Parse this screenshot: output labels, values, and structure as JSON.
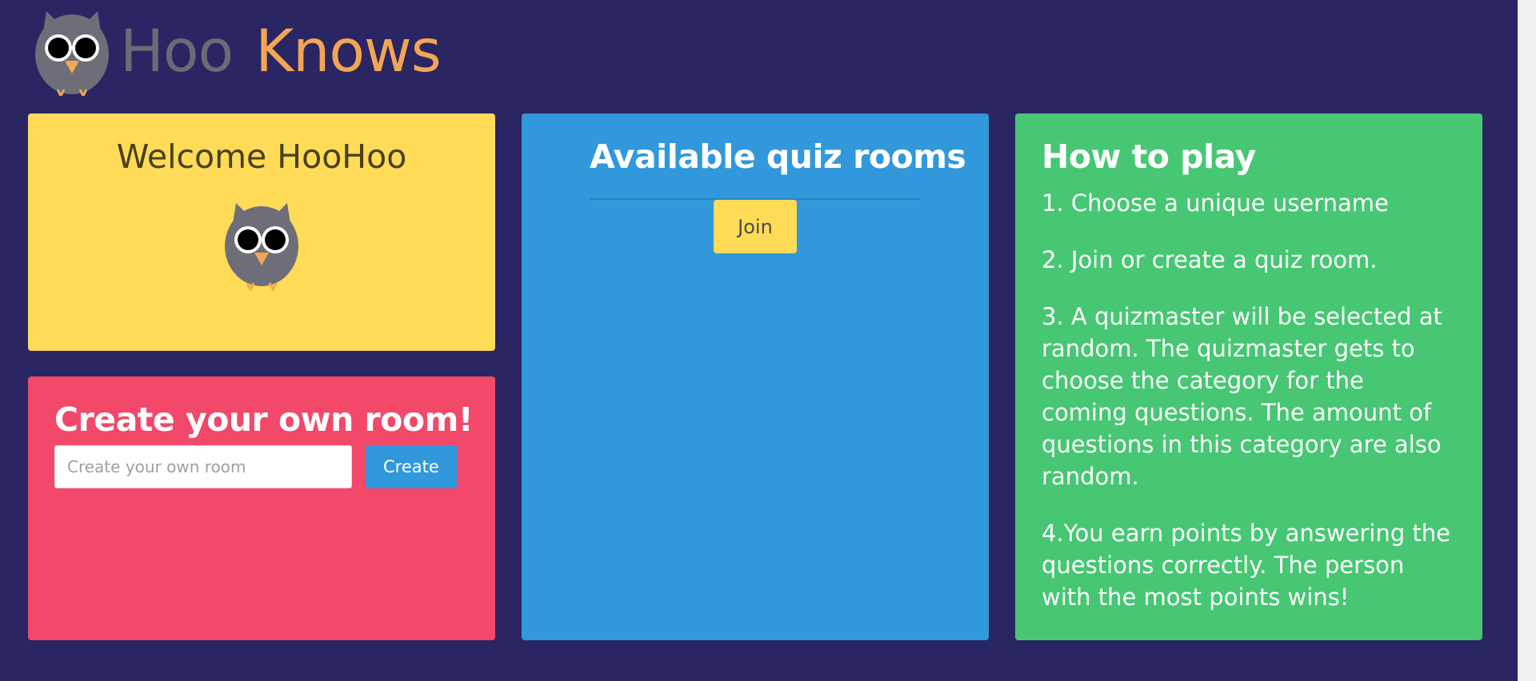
{
  "header": {
    "brand_part1": "Hoo",
    "brand_part2": "Knows",
    "logo_icon": "owl-icon"
  },
  "welcome": {
    "title": "Welcome HooHoo",
    "avatar_icon": "owl-icon"
  },
  "create_room": {
    "title": "Create your own room!",
    "input_value": "",
    "input_placeholder": "Create your own room",
    "button_label": "Create"
  },
  "rooms": {
    "title": "Available quiz rooms",
    "join_label": "Join"
  },
  "how_to": {
    "title": "How to play",
    "steps": [
      "1. Choose a unique username",
      "2. Join or create a quiz room.",
      "3. A quizmaster will be selected at random. The quizmaster gets to choose the category for the coming questions. The amount of questions in this category are also random.",
      "4.You earn points by answering the questions correctly. The person with the most points wins!"
    ]
  },
  "colors": {
    "background": "#2a2563",
    "welcome_card": "#ffdb58",
    "create_card": "#f2486a",
    "rooms_card": "#3198db",
    "howto_card": "#47c773",
    "brand_accent": "#f2a654"
  }
}
